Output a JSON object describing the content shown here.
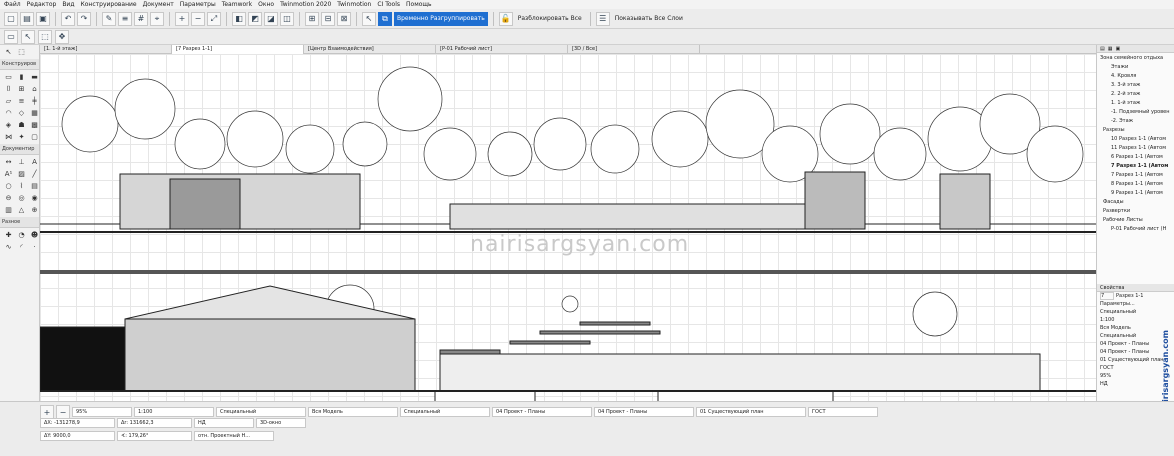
{
  "menu": [
    "Файл",
    "Редактор",
    "Вид",
    "Конструирование",
    "Документ",
    "Параметры",
    "Teamwork",
    "Окно",
    "Twinmotion 2020",
    "Twinmotion",
    "CI Tools",
    "Помощь"
  ],
  "toolbar": {
    "regroup": "Временно Разгруппировать",
    "unlock_all": "Разблокировать Все",
    "show_all_layers": "Показывать Все Слои"
  },
  "toolbox": {
    "sections": [
      "Конструиров",
      "Документир",
      "Разное"
    ]
  },
  "tabs": [
    "[1. 1-й этаж]",
    "[7 Разрез 1-1]",
    "[Центр Взаимодействия]",
    "[P-01 Рабочий лист]",
    "[3D / Все]"
  ],
  "watermark": "nairisargsyan.com",
  "navigator": {
    "items": [
      {
        "label": "Зона семейного отдыха",
        "bold": false
      },
      {
        "label": "Этажи",
        "bold": false
      },
      {
        "label": "4. Кровля",
        "bold": false
      },
      {
        "label": "3. 3-й этаж",
        "bold": false
      },
      {
        "label": "2. 2-й этаж",
        "bold": false
      },
      {
        "label": "1. 1-й этаж",
        "bold": false
      },
      {
        "label": "-1. Подземный уровен",
        "bold": false
      },
      {
        "label": "-2. Этаж",
        "bold": false
      },
      {
        "label": "Разрезы",
        "bold": false
      },
      {
        "label": "10 Разрез 1-1 (Автом",
        "bold": false
      },
      {
        "label": "11 Разрез 1-1 (Автом",
        "bold": false
      },
      {
        "label": "6 Разрез 1-1 (Автом",
        "bold": false
      },
      {
        "label": "7 Разрез 1-1 (Автом",
        "bold": true
      },
      {
        "label": "7 Разрез 1-1 (Автом",
        "bold": false
      },
      {
        "label": "8 Разрез 1-1 (Автом",
        "bold": false
      },
      {
        "label": "9 Разрез 1-1 (Автом",
        "bold": false
      },
      {
        "label": "Фасады",
        "bold": false
      },
      {
        "label": "Развертки",
        "bold": false
      },
      {
        "label": "Рабочие Листы",
        "bold": false
      },
      {
        "label": "P-01 Рабочий лист (Н",
        "bold": false
      }
    ]
  },
  "props": {
    "title": "Свойства",
    "id": "7",
    "name": "Разрез 1-1",
    "params": "Параметры...",
    "items": [
      "Специальный",
      "1:100",
      "Вся Модель",
      "Специальный",
      "04 Проект - Планы",
      "04 Проект - Планы",
      "01 Существующий план",
      "ГОСТ",
      "95%",
      "НД"
    ]
  },
  "status": {
    "zoom": "95%",
    "dx": "ΔX: -131278,9",
    "dy": "ΔY: 9000,0",
    "dr": "Δr: 131662,3",
    "angle": "∢: 179,26°",
    "nd": "НД",
    "proj": "отн. Проектный Н...",
    "three_d": "3D-окно",
    "scale": "1:100",
    "special": "Специальный",
    "model": "Вся Модель",
    "special2": "Специальный",
    "plans1": "04 Проект - Планы",
    "plans2": "04 Проект - Планы",
    "existing": "01 Существующий план",
    "gost": "ГОСТ"
  },
  "author_tag": "nairisargsyan.com"
}
